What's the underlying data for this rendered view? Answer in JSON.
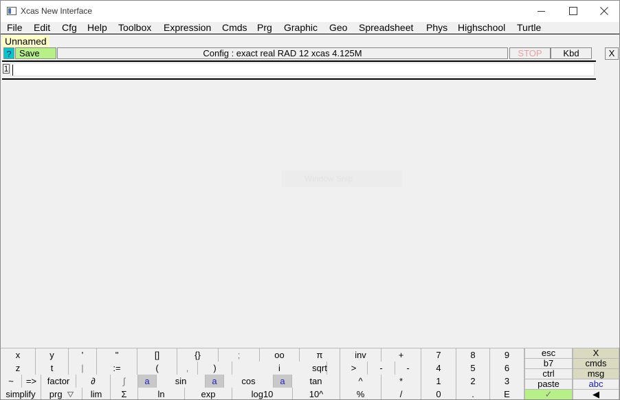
{
  "window": {
    "title": "Xcas New Interface"
  },
  "menu": [
    "File",
    "Edit",
    "Cfg",
    "Help",
    "Toolbox",
    "Expression",
    "Cmds",
    "Prg",
    "Graphic",
    "Geo",
    "Spreadsheet",
    "Phys",
    "Highschool",
    "Turtle"
  ],
  "session": {
    "tab_label": "Unnamed"
  },
  "toolbar": {
    "help_label": "?",
    "save_label": "Save",
    "config_text": "Config  : exact real RAD 12 xcas 4.125M",
    "stop_label": "STOP",
    "kbd_label": "Kbd",
    "close_label": "X"
  },
  "command": {
    "index": "1",
    "value": ""
  },
  "ghost_text": "Window Snip",
  "keyboard": {
    "row1": [
      "x",
      "y",
      "'",
      "\"",
      "[]",
      "{}",
      ";",
      "oo",
      "π",
      "inv",
      "+",
      "7",
      "8",
      "9"
    ],
    "row2": [
      "z",
      "t",
      "|",
      ":=",
      "(",
      ",",
      ")",
      "i",
      "sqrt",
      ">",
      "-",
      "-",
      "4",
      "5",
      "6"
    ],
    "row3": [
      "~",
      "=>",
      "factor",
      "∂",
      "∫",
      "a",
      "sin",
      "a",
      "cos",
      "a",
      "tan",
      "^",
      "*",
      "1",
      "2",
      "3"
    ],
    "row4": [
      "simplify",
      "prg",
      "lim",
      "Σ",
      "ln",
      "exp",
      "log10",
      "10^",
      "%",
      "/",
      "0",
      ".",
      "E"
    ],
    "side": [
      "esc",
      "X",
      "b7",
      "cmds",
      "ctrl",
      "msg",
      "paste",
      "abc",
      "✓",
      "◀"
    ]
  }
}
